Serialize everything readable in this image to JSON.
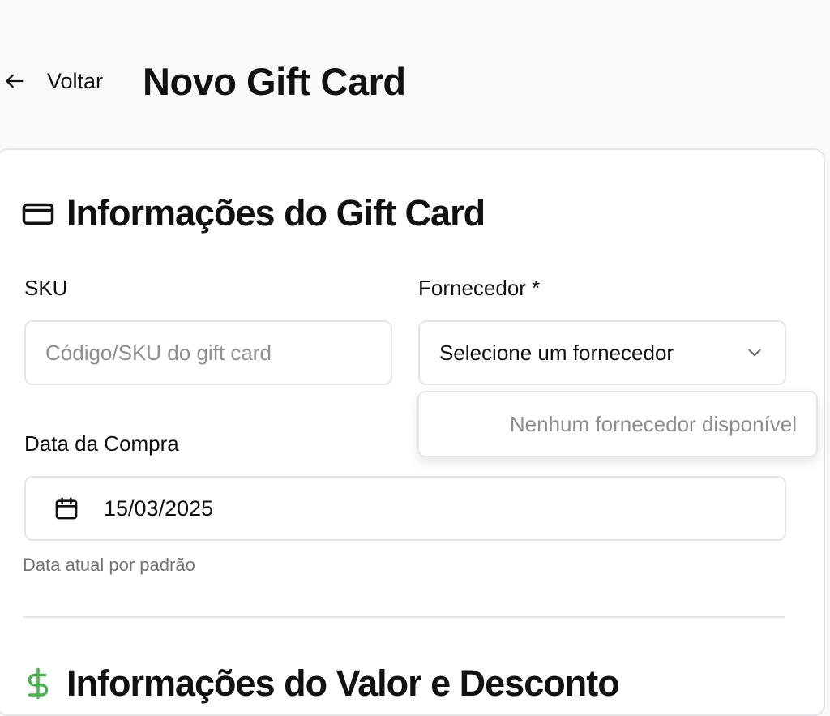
{
  "header": {
    "back_label": "Voltar",
    "title": "Novo Gift Card"
  },
  "sections": [
    {
      "title": "Informações do Gift Card",
      "icon": "credit-card-icon"
    },
    {
      "title": "Informações do Valor e Desconto",
      "icon": "dollar-icon",
      "icon_color": "#4caf50"
    }
  ],
  "form": {
    "sku": {
      "label": "SKU",
      "value": "",
      "placeholder": "Código/SKU do gift card"
    },
    "supplier": {
      "label": "Fornecedor *",
      "selected": "Selecione um fornecedor",
      "empty_option": "Nenhum fornecedor disponível"
    },
    "purchase_date": {
      "label": "Data da Compra",
      "value": "15/03/2025",
      "help": "Data atual por padrão"
    }
  }
}
